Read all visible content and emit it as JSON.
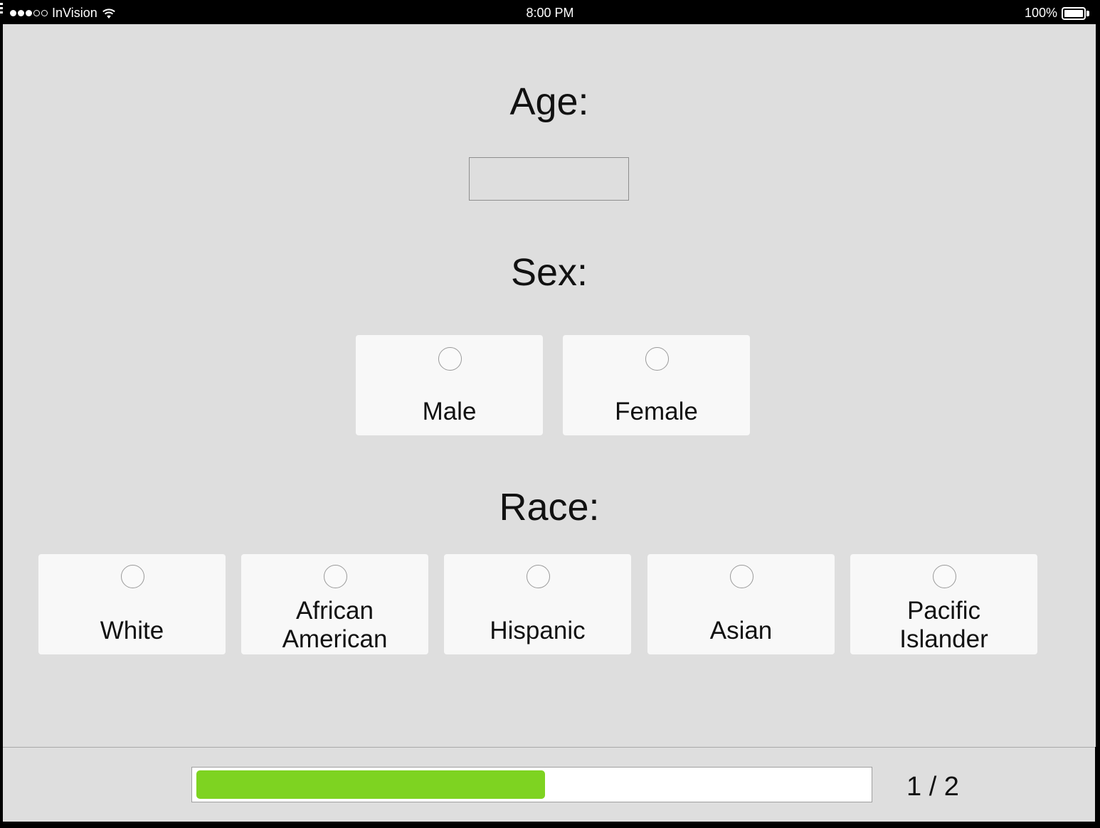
{
  "status_bar": {
    "signal_bars_filled": 3,
    "signal_bars_total": 5,
    "carrier": "InVision",
    "time": "8:00 PM",
    "battery_percent": "100%",
    "icons": [
      "wifi-icon",
      "battery-icon"
    ]
  },
  "form": {
    "age": {
      "label": "Age:",
      "value": "",
      "placeholder": ""
    },
    "sex": {
      "label": "Sex:",
      "options": [
        "Male",
        "Female"
      ]
    },
    "race": {
      "label": "Race:",
      "options": [
        "White",
        "African\nAmerican",
        "Hispanic",
        "Asian",
        "Pacific\nIslander"
      ]
    }
  },
  "footer": {
    "progress_fraction": 0.52,
    "page_indicator": "1 / 2",
    "progress_color": "#7ed321"
  },
  "colors": {
    "background": "#dedede",
    "card": "#f8f8f8",
    "accent": "#7ed321"
  }
}
